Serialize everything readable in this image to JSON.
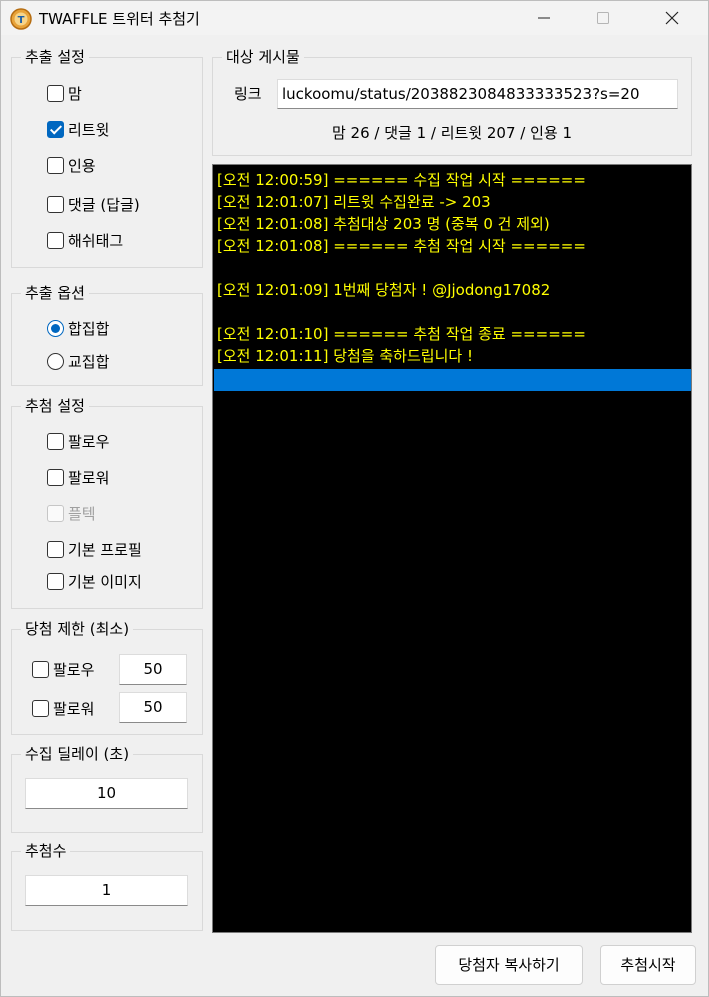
{
  "window": {
    "title": "TWAFFLE 트위터 추첨기"
  },
  "extract_settings": {
    "title": "추출 설정",
    "options": [
      {
        "label": "맘",
        "checked": false
      },
      {
        "label": "리트윗",
        "checked": true
      },
      {
        "label": "인용",
        "checked": false
      },
      {
        "label": "댓글 (답글)",
        "checked": false
      },
      {
        "label": "해쉬태그",
        "checked": false
      }
    ]
  },
  "extract_options": {
    "title": "추출 옵션",
    "options": [
      {
        "label": "합집합",
        "selected": true
      },
      {
        "label": "교집합",
        "selected": false
      }
    ]
  },
  "draw_settings": {
    "title": "추첨 설정",
    "options": [
      {
        "label": "팔로우",
        "checked": false,
        "disabled": false
      },
      {
        "label": "팔로워",
        "checked": false,
        "disabled": false
      },
      {
        "label": "플텍",
        "checked": false,
        "disabled": true
      },
      {
        "label": "기본 프로필",
        "checked": false,
        "disabled": false
      },
      {
        "label": "기본 이미지",
        "checked": false,
        "disabled": false
      }
    ]
  },
  "win_limit": {
    "title": "당첨 제한 (최소)",
    "follow_label": "팔로우",
    "follow_value": "50",
    "follower_label": "팔로워",
    "follower_value": "50"
  },
  "collect_delay": {
    "title": "수집 딜레이 (초)",
    "value": "10"
  },
  "draw_count": {
    "title": "추첨수",
    "value": "1"
  },
  "target_post": {
    "title": "대상 게시물",
    "link_label": "링크",
    "link_value": "luckoomu/status/2038823084833333523?s=20",
    "stats": "맘 26 / 댓글 1 / 리트윗 207 / 인용 1"
  },
  "log": {
    "lines": [
      "[오전 12:00:59] ====== 수집 작업 시작 ======",
      "[오전 12:01:07] 리트윗 수집완료 -> 203",
      "[오전 12:01:08] 추첨대상 203 명 (중복 0 건 제외)",
      "[오전 12:01:08] ====== 추첨 작업 시작 ======",
      "",
      "[오전 12:01:09] 1번째 당첨자 ! @Jjodong17082",
      "",
      "[오전 12:01:10] ====== 추첨 작업 종료 ======",
      "[오전 12:01:11] 당첨을 축하드립니다 !"
    ],
    "text_color": "#ffff00",
    "background": "#000000",
    "selection_color": "#0078d7"
  },
  "buttons": {
    "copy_winner": "당첨자 복사하기",
    "start_draw": "추첨시작"
  },
  "icons": {
    "app": "twaffle-logo-icon",
    "minimize": "minimize-icon",
    "maximize": "maximize-icon",
    "close": "close-icon"
  },
  "accent_color": "#0067c0"
}
